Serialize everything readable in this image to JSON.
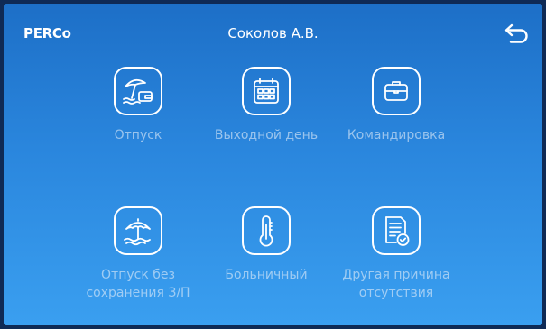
{
  "header": {
    "logo": "PERCo",
    "user_name": "Соколов А.В."
  },
  "tiles": [
    {
      "label": "Отпуск",
      "icon": "beach-umbrella-wallet-icon"
    },
    {
      "label": "Выходной день",
      "icon": "calendar-icon"
    },
    {
      "label": "Командировка",
      "icon": "briefcase-icon"
    },
    {
      "label": "Отпуск без сохранения З/П",
      "icon": "beach-umbrella-icon"
    },
    {
      "label": "Больничный",
      "icon": "thermometer-icon"
    },
    {
      "label": "Другая причина отсутствия",
      "icon": "document-check-icon"
    }
  ],
  "colors": {
    "background_top": "#1d6fc7",
    "background_bottom": "#3a9ff0",
    "foreground": "#ffffff",
    "label_muted": "#c8d8ee"
  }
}
